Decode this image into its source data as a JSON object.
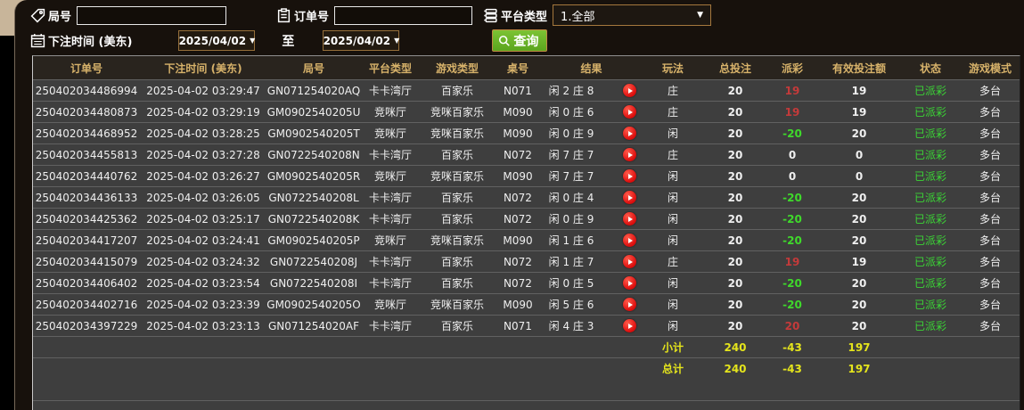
{
  "filters": {
    "round_label": "局号",
    "round_value": "",
    "order_label": "订单号",
    "order_value": "",
    "platform_label": "平台类型",
    "platform_value": "1.全部",
    "bet_time_label": "下注时间 (美东)",
    "date_from": "2025/04/02",
    "to_label": "至",
    "date_to": "2025/04/02",
    "query_label": "查询"
  },
  "table": {
    "headers": [
      "订单号",
      "下注时间 (美东)",
      "局号",
      "平台类型",
      "游戏类型",
      "桌号",
      "结果",
      "玩法",
      "总投注",
      "派彩",
      "有效投注额",
      "状态",
      "游戏模式"
    ],
    "rows": [
      {
        "order": "250402034486994",
        "time": "2025-04-02 03:29:47",
        "round": "GN071254020AQ",
        "platform": "卡卡湾厅",
        "game": "百家乐",
        "table_no": "N071",
        "result": "闲 2 庄 8",
        "bet_type": "庄",
        "total": "20",
        "payout": "19",
        "valid": "19",
        "status": "已派彩",
        "mode": "多台"
      },
      {
        "order": "250402034480873",
        "time": "2025-04-02 03:29:19",
        "round": "GM0902540205U",
        "platform": "竞咪厅",
        "game": "竞咪百家乐",
        "table_no": "M090",
        "result": "闲 0 庄 6",
        "bet_type": "庄",
        "total": "20",
        "payout": "19",
        "valid": "19",
        "status": "已派彩",
        "mode": "多台"
      },
      {
        "order": "250402034468952",
        "time": "2025-04-02 03:28:25",
        "round": "GM0902540205T",
        "platform": "竞咪厅",
        "game": "竞咪百家乐",
        "table_no": "M090",
        "result": "闲 0 庄 9",
        "bet_type": "闲",
        "total": "20",
        "payout": "-20",
        "valid": "20",
        "status": "已派彩",
        "mode": "多台"
      },
      {
        "order": "250402034455813",
        "time": "2025-04-02 03:27:28",
        "round": "GN0722540208N",
        "platform": "卡卡湾厅",
        "game": "百家乐",
        "table_no": "N072",
        "result": "闲 7 庄 7",
        "bet_type": "庄",
        "total": "20",
        "payout": "0",
        "valid": "0",
        "status": "已派彩",
        "mode": "多台"
      },
      {
        "order": "250402034440762",
        "time": "2025-04-02 03:26:27",
        "round": "GM0902540205R",
        "platform": "竞咪厅",
        "game": "竞咪百家乐",
        "table_no": "M090",
        "result": "闲 7 庄 7",
        "bet_type": "闲",
        "total": "20",
        "payout": "0",
        "valid": "0",
        "status": "已派彩",
        "mode": "多台"
      },
      {
        "order": "250402034436133",
        "time": "2025-04-02 03:26:05",
        "round": "GN0722540208L",
        "platform": "卡卡湾厅",
        "game": "百家乐",
        "table_no": "N072",
        "result": "闲 0 庄 4",
        "bet_type": "闲",
        "total": "20",
        "payout": "-20",
        "valid": "20",
        "status": "已派彩",
        "mode": "多台"
      },
      {
        "order": "250402034425362",
        "time": "2025-04-02 03:25:17",
        "round": "GN0722540208K",
        "platform": "卡卡湾厅",
        "game": "百家乐",
        "table_no": "N072",
        "result": "闲 0 庄 9",
        "bet_type": "闲",
        "total": "20",
        "payout": "-20",
        "valid": "20",
        "status": "已派彩",
        "mode": "多台"
      },
      {
        "order": "250402034417207",
        "time": "2025-04-02 03:24:41",
        "round": "GM0902540205P",
        "platform": "竞咪厅",
        "game": "竞咪百家乐",
        "table_no": "M090",
        "result": "闲 1 庄 6",
        "bet_type": "闲",
        "total": "20",
        "payout": "-20",
        "valid": "20",
        "status": "已派彩",
        "mode": "多台"
      },
      {
        "order": "250402034415079",
        "time": "2025-04-02 03:24:32",
        "round": "GN0722540208J",
        "platform": "卡卡湾厅",
        "game": "百家乐",
        "table_no": "N072",
        "result": "闲 1 庄 7",
        "bet_type": "庄",
        "total": "20",
        "payout": "19",
        "valid": "19",
        "status": "已派彩",
        "mode": "多台"
      },
      {
        "order": "250402034406402",
        "time": "2025-04-02 03:23:54",
        "round": "GN0722540208I",
        "platform": "卡卡湾厅",
        "game": "百家乐",
        "table_no": "N072",
        "result": "闲 0 庄 5",
        "bet_type": "闲",
        "total": "20",
        "payout": "-20",
        "valid": "20",
        "status": "已派彩",
        "mode": "多台"
      },
      {
        "order": "250402034402716",
        "time": "2025-04-02 03:23:39",
        "round": "GM0902540205O",
        "platform": "竞咪厅",
        "game": "竞咪百家乐",
        "table_no": "M090",
        "result": "闲 5 庄 6",
        "bet_type": "闲",
        "total": "20",
        "payout": "-20",
        "valid": "20",
        "status": "已派彩",
        "mode": "多台"
      },
      {
        "order": "250402034397229",
        "time": "2025-04-02 03:23:13",
        "round": "GN071254020AF",
        "platform": "卡卡湾厅",
        "game": "百家乐",
        "table_no": "N071",
        "result": "闲 4 庄 3",
        "bet_type": "闲",
        "total": "20",
        "payout": "20",
        "valid": "20",
        "status": "已派彩",
        "mode": "多台"
      }
    ],
    "subtotal": {
      "label": "小计",
      "total": "240",
      "payout": "-43",
      "valid": "197"
    },
    "grand_total": {
      "label": "总计",
      "total": "240",
      "payout": "-43",
      "valid": "197"
    }
  },
  "colors": {
    "payout_positive": "#c43a3a",
    "payout_negative": "#3fd92b",
    "status_paid": "#3bd435",
    "totals_yellow": "#e4e41c",
    "header_gold": "#d7b26a",
    "query_green": "#6ab528",
    "border_orange": "#a5783d"
  }
}
